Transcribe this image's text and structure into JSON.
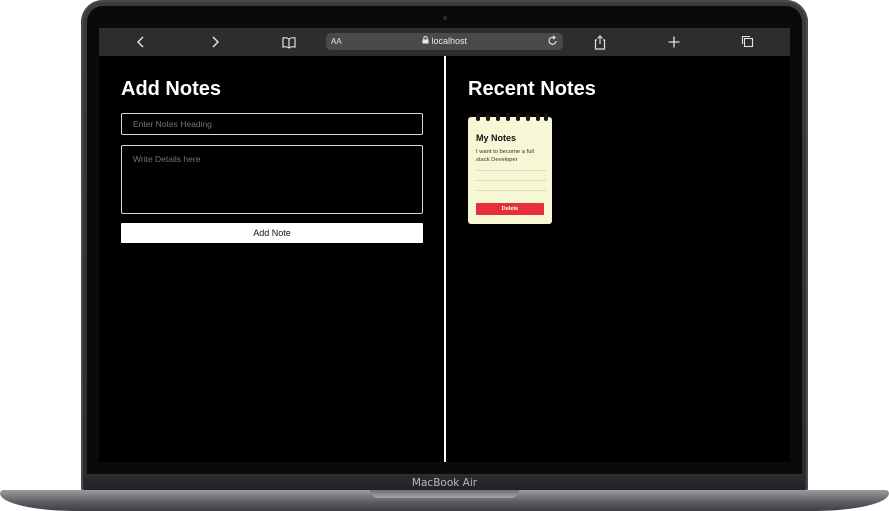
{
  "browser": {
    "url_host": "localhost",
    "text_size_label": "AA",
    "icons": {
      "back": "chevron-left",
      "forward": "chevron-right",
      "bookmarks": "open-book",
      "lock": "padlock",
      "reload": "circular-arrow",
      "share": "share-box-arrow",
      "new_tab": "plus",
      "tabs": "overlapping-squares"
    }
  },
  "add_notes": {
    "heading": "Add Notes",
    "heading_placeholder": "Enter Notes Heading",
    "details_placeholder": "Write Details here",
    "submit_label": "Add Note"
  },
  "recent_notes": {
    "heading": "Recent Notes",
    "notes": [
      {
        "title": "My Notes",
        "body": "I want to become a full stack Developer",
        "delete_label": "Delete"
      }
    ]
  },
  "device": {
    "label": "MacBook Air"
  },
  "colors": {
    "page_bg": "#000000",
    "note_bg": "#f7f7d5",
    "delete_bg": "#e5303a",
    "toolbar_bg": "#2d2d2f"
  }
}
